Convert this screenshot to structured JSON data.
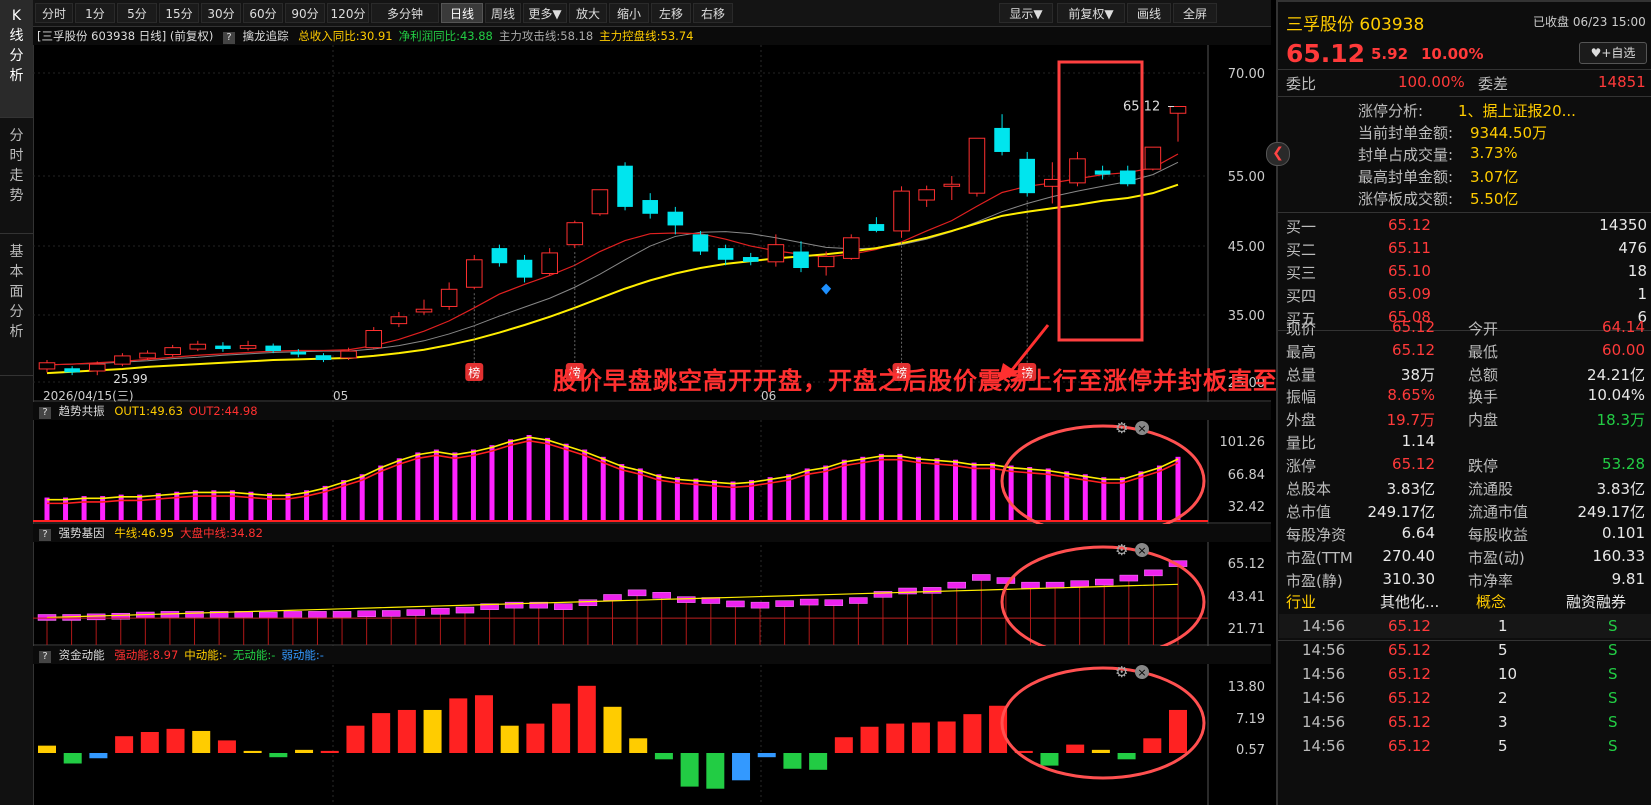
{
  "toolbar": {
    "buttons": [
      "分时",
      "1分",
      "5分",
      "15分",
      "30分",
      "60分",
      "90分",
      "120分",
      "多分钟",
      "日线",
      "周线",
      "更多▼",
      "放大",
      "缩小",
      "左移",
      "右移"
    ],
    "right_buttons": [
      "显示▼",
      "前复权▼",
      "画线",
      "全屏"
    ]
  },
  "left_tabs": [
    "K线分析",
    "分时走势",
    "基本面分析"
  ],
  "main_header": {
    "title": "[三孚股份 603938 日线] (前复权)",
    "indicator": "擒龙追踪",
    "items": [
      {
        "text": "总收入同比:30.91",
        "color": "#ffcc00"
      },
      {
        "text": "净利润同比:43.88",
        "color": "#22cc44"
      },
      {
        "text": "主力攻击线:58.18",
        "color": "#aaaaaa"
      },
      {
        "text": "主力控盘线:53.74",
        "color": "#ffcc00"
      }
    ]
  },
  "price_axis": [
    "70.00",
    "55.00",
    "45.00",
    "35.00",
    "25.00"
  ],
  "date_labels": {
    "left": "2026/04/15(三)",
    "m1": "05",
    "m2": "06"
  },
  "low_label": "25.99",
  "high_label": "65.12",
  "bang_label": "榜",
  "annotation": "股价早盘跳空高开开盘，开盘之后股价震荡上行至涨停并封板直至尾盘收盘",
  "pane2": {
    "title": "趋势共振",
    "items": [
      {
        "text": "OUT1:49.63",
        "color": "#ffcc00"
      },
      {
        "text": "OUT2:44.98",
        "color": "#ff3030"
      }
    ],
    "axis": [
      "101.26",
      "66.84",
      "32.42"
    ]
  },
  "pane3": {
    "title": "强势基因",
    "items": [
      {
        "text": "牛线:46.95",
        "color": "#ffcc00"
      },
      {
        "text": "大盘中线:34.82",
        "color": "#ff3030"
      }
    ],
    "axis": [
      "65.12",
      "43.41",
      "21.71"
    ]
  },
  "pane4": {
    "title": "资金动能",
    "items": [
      {
        "text": "强动能:8.97",
        "color": "#ff3030"
      },
      {
        "text": "中动能:-",
        "color": "#ffcc00"
      },
      {
        "text": "无动能:-",
        "color": "#22cc44"
      },
      {
        "text": "弱动能:-",
        "color": "#3399ff"
      }
    ],
    "axis": [
      "13.80",
      "7.19",
      "0.57"
    ]
  },
  "quote": {
    "name": "三孚股份 603938",
    "status": "已收盘 06/23 15:00",
    "price": "65.12",
    "change": "5.92",
    "pct": "10.00%",
    "fav": "+自选",
    "weibi_label": "委比",
    "weibi": "100.00%",
    "weicha_label": "委差",
    "weicha": "14851",
    "limit_info": [
      {
        "k": "涨停分析:",
        "v": "1、据上证报20..."
      },
      {
        "k": "当前封单金额:",
        "v": "9344.50万"
      },
      {
        "k": "封单占成交量:",
        "v": "3.73%"
      },
      {
        "k": "最高封单金额:",
        "v": "3.07亿"
      },
      {
        "k": "涨停板成交额:",
        "v": "5.50亿"
      }
    ],
    "bids": [
      {
        "k": "买一",
        "p": "65.12",
        "v": "14350"
      },
      {
        "k": "买二",
        "p": "65.11",
        "v": "476"
      },
      {
        "k": "买三",
        "p": "65.10",
        "v": "18"
      },
      {
        "k": "买四",
        "p": "65.09",
        "v": "1"
      },
      {
        "k": "买五",
        "p": "65.08",
        "v": "6"
      }
    ],
    "stats1": [
      {
        "k1": "现价",
        "v1": "65.12",
        "c1": "red",
        "k2": "今开",
        "v2": "64.14",
        "c2": "red"
      },
      {
        "k1": "最高",
        "v1": "65.12",
        "c1": "red",
        "k2": "最低",
        "v2": "60.00",
        "c2": "red"
      },
      {
        "k1": "总量",
        "v1": "38万",
        "c1": "white",
        "k2": "总额",
        "v2": "24.21亿",
        "c2": "white"
      }
    ],
    "stats2": [
      {
        "k1": "振幅",
        "v1": "8.65%",
        "c1": "red",
        "k2": "换手",
        "v2": "10.04%",
        "c2": "white"
      },
      {
        "k1": "外盘",
        "v1": "19.7万",
        "c1": "red",
        "k2": "内盘",
        "v2": "18.3万",
        "c2": "green"
      },
      {
        "k1": "量比",
        "v1": "1.14",
        "c1": "white",
        "k2": "",
        "v2": "",
        "c2": "white"
      }
    ],
    "stats3": [
      {
        "k1": "涨停",
        "v1": "65.12",
        "c1": "red",
        "k2": "跌停",
        "v2": "53.28",
        "c2": "green"
      },
      {
        "k1": "总股本",
        "v1": "3.83亿",
        "c1": "white",
        "k2": "流通股",
        "v2": "3.83亿",
        "c2": "white"
      },
      {
        "k1": "总市值",
        "v1": "249.17亿",
        "c1": "white",
        "k2": "流通市值",
        "v2": "249.17亿",
        "c2": "white"
      },
      {
        "k1": "每股净资",
        "v1": "6.64",
        "c1": "white",
        "k2": "每股收益",
        "v2": "0.101",
        "c2": "white"
      },
      {
        "k1": "市盈(TTM",
        "v1": "270.40",
        "c1": "white",
        "k2": "市盈(动)",
        "v2": "160.33",
        "c2": "white"
      },
      {
        "k1": "市盈(静)",
        "v1": "310.30",
        "c1": "white",
        "k2": "市净率",
        "v2": "9.81",
        "c2": "white"
      }
    ],
    "tags": [
      "行业",
      "其他化...",
      "概念",
      "融资融券"
    ],
    "ticks": [
      {
        "t": "14:56",
        "p": "65.12",
        "v": "1",
        "s": "S"
      },
      {
        "t": "14:56",
        "p": "65.12",
        "v": "5",
        "s": "S"
      },
      {
        "t": "14:56",
        "p": "65.12",
        "v": "10",
        "s": "S"
      },
      {
        "t": "14:56",
        "p": "65.12",
        "v": "2",
        "s": "S"
      },
      {
        "t": "14:56",
        "p": "65.12",
        "v": "3",
        "s": "S"
      },
      {
        "t": "14:56",
        "p": "65.12",
        "v": "5",
        "s": "S"
      }
    ]
  },
  "chart_data": {
    "type": "candlestick",
    "ylim": [
      25,
      72
    ],
    "candles": [
      {
        "o": 26.9,
        "c": 27.8,
        "h": 28.2,
        "l": 26.4
      },
      {
        "o": 27.0,
        "c": 26.4,
        "h": 27.3,
        "l": 26.0
      },
      {
        "o": 26.6,
        "c": 27.6,
        "h": 28.0,
        "l": 25.99
      },
      {
        "o": 27.6,
        "c": 28.8,
        "h": 29.2,
        "l": 27.3
      },
      {
        "o": 28.5,
        "c": 29.2,
        "h": 29.6,
        "l": 28.2
      },
      {
        "o": 29.0,
        "c": 30.0,
        "h": 30.4,
        "l": 28.7
      },
      {
        "o": 29.8,
        "c": 30.5,
        "h": 31.0,
        "l": 29.5
      },
      {
        "o": 30.3,
        "c": 29.8,
        "h": 30.8,
        "l": 29.4
      },
      {
        "o": 29.9,
        "c": 30.3,
        "h": 31.0,
        "l": 29.6
      },
      {
        "o": 30.3,
        "c": 29.5,
        "h": 30.6,
        "l": 29.2
      },
      {
        "o": 29.4,
        "c": 29.0,
        "h": 29.8,
        "l": 28.6
      },
      {
        "o": 28.9,
        "c": 28.2,
        "h": 29.2,
        "l": 27.9
      },
      {
        "o": 28.5,
        "c": 29.5,
        "h": 30.0,
        "l": 28.2
      },
      {
        "o": 30.0,
        "c": 32.5,
        "h": 33.0,
        "l": 29.8
      },
      {
        "o": 33.5,
        "c": 34.5,
        "h": 35.2,
        "l": 33.0
      },
      {
        "o": 35.2,
        "c": 35.6,
        "h": 37.0,
        "l": 34.8
      },
      {
        "o": 36.0,
        "c": 38.5,
        "h": 39.5,
        "l": 35.5
      },
      {
        "o": 38.8,
        "c": 42.8,
        "h": 43.5,
        "l": 38.5
      },
      {
        "o": 44.5,
        "c": 42.3,
        "h": 45.0,
        "l": 41.8
      },
      {
        "o": 42.8,
        "c": 40.2,
        "h": 43.5,
        "l": 39.5
      },
      {
        "o": 40.8,
        "c": 43.8,
        "h": 44.5,
        "l": 40.5
      },
      {
        "o": 45.0,
        "c": 48.2,
        "h": 48.5,
        "l": 44.5
      },
      {
        "o": 49.5,
        "c": 53.0,
        "h": 53.0,
        "l": 49.2
      },
      {
        "o": 56.5,
        "c": 50.5,
        "h": 57.0,
        "l": 50.0
      },
      {
        "o": 51.5,
        "c": 49.5,
        "h": 52.5,
        "l": 48.8
      },
      {
        "o": 49.8,
        "c": 47.8,
        "h": 50.5,
        "l": 46.5
      },
      {
        "o": 46.5,
        "c": 44.0,
        "h": 47.0,
        "l": 43.5
      },
      {
        "o": 44.5,
        "c": 42.8,
        "h": 45.0,
        "l": 42.0
      },
      {
        "o": 43.2,
        "c": 42.5,
        "h": 43.8,
        "l": 42.0
      },
      {
        "o": 42.5,
        "c": 45.0,
        "h": 46.5,
        "l": 41.8
      },
      {
        "o": 44.0,
        "c": 41.6,
        "h": 45.5,
        "l": 41.0
      },
      {
        "o": 41.8,
        "c": 43.3,
        "h": 44.0,
        "l": 40.5
      },
      {
        "o": 43.0,
        "c": 46.0,
        "h": 46.5,
        "l": 42.8
      },
      {
        "o": 48.0,
        "c": 47.0,
        "h": 49.0,
        "l": 46.8
      },
      {
        "o": 47.0,
        "c": 52.8,
        "h": 53.5,
        "l": 46.0
      },
      {
        "o": 51.5,
        "c": 53.0,
        "h": 53.6,
        "l": 50.5
      },
      {
        "o": 53.5,
        "c": 53.8,
        "h": 55.0,
        "l": 51.5
      },
      {
        "o": 52.5,
        "c": 60.5,
        "h": 60.5,
        "l": 52.0
      },
      {
        "o": 62.0,
        "c": 58.5,
        "h": 64.0,
        "l": 58.0
      },
      {
        "o": 57.5,
        "c": 52.5,
        "h": 58.5,
        "l": 52.0
      },
      {
        "o": 53.5,
        "c": 54.5,
        "h": 57.0,
        "l": 51.0
      },
      {
        "o": 54.0,
        "c": 57.5,
        "h": 58.5,
        "l": 53.5
      },
      {
        "o": 55.8,
        "c": 55.2,
        "h": 56.5,
        "l": 54.5
      },
      {
        "o": 55.8,
        "c": 53.8,
        "h": 56.5,
        "l": 53.5
      },
      {
        "o": 56.0,
        "c": 59.2,
        "h": 59.2,
        "l": 55.8
      },
      {
        "o": 64.14,
        "c": 65.12,
        "h": 65.12,
        "l": 60.0
      }
    ],
    "ma_red": [
      27.5,
      27.6,
      27.8,
      28.0,
      28.3,
      28.6,
      28.9,
      29.1,
      29.3,
      29.5,
      29.6,
      29.6,
      29.7,
      30.3,
      31.2,
      32.4,
      33.9,
      35.8,
      37.8,
      39.2,
      40.5,
      42.0,
      44.0,
      45.6,
      46.6,
      46.7,
      46.6,
      45.8,
      44.8,
      44.1,
      43.6,
      43.2,
      43.6,
      44.3,
      45.4,
      47.0,
      48.5,
      50.6,
      52.6,
      53.5,
      54.0,
      54.6,
      55.2,
      55.5,
      56.2,
      58.2
    ],
    "ma_gray": [
      27.5,
      27.6,
      27.7,
      27.9,
      28.1,
      28.4,
      28.6,
      28.9,
      29.1,
      29.3,
      29.4,
      29.5,
      29.5,
      29.8,
      30.3,
      31.0,
      32.0,
      33.2,
      34.6,
      35.9,
      37.2,
      38.8,
      40.7,
      42.8,
      44.8,
      46.2,
      46.8,
      46.9,
      46.6,
      46.0,
      45.3,
      44.6,
      44.4,
      44.5,
      45.0,
      45.8,
      46.9,
      48.3,
      49.8,
      51.0,
      52.0,
      52.8,
      53.5,
      54.2,
      55.2,
      57.0
    ],
    "ma_yellow": [
      26.3,
      26.5,
      26.7,
      26.9,
      27.2,
      27.4,
      27.6,
      27.8,
      28.0,
      28.2,
      28.3,
      28.4,
      28.5,
      28.8,
      29.2,
      29.7,
      30.4,
      31.2,
      32.2,
      33.3,
      34.5,
      35.8,
      37.2,
      38.6,
      39.8,
      40.8,
      41.6,
      42.2,
      42.6,
      43.0,
      43.3,
      43.6,
      44.0,
      44.5,
      45.2,
      46.0,
      47.0,
      48.1,
      49.2,
      49.8,
      50.3,
      50.8,
      51.4,
      51.8,
      52.5,
      53.74
    ],
    "bang_idx": [
      17,
      21,
      34,
      39
    ],
    "trend_bars": [
      12,
      12,
      13,
      13,
      14,
      14,
      15,
      16,
      17,
      17,
      17,
      16,
      15,
      15,
      17,
      20,
      24,
      28,
      34,
      39,
      43,
      45,
      43,
      45,
      48,
      52,
      55,
      53,
      49,
      45,
      40,
      35,
      32,
      28,
      26,
      25,
      24,
      23,
      24,
      26,
      28,
      32,
      34,
      38,
      40,
      42,
      42,
      40,
      39,
      38,
      36,
      36,
      34,
      33,
      32,
      30,
      28,
      26,
      26,
      30,
      34,
      40
    ],
    "gene_bars": [
      7.0,
      7.0,
      7.2,
      7.4,
      7.8,
      8.0,
      8.0,
      8.0,
      8.0,
      7.8,
      8.0,
      8.0,
      8.0,
      8.2,
      8.3,
      8.6,
      9.0,
      9.4,
      10.5,
      11.0,
      11.0,
      10.5,
      11.8,
      13.5,
      15.0,
      14.2,
      12.8,
      12.5,
      11.4,
      11.0,
      11.5,
      12.0,
      11.8,
      12.5,
      14.5,
      15.6,
      15.8,
      17.5,
      20.0,
      19.0,
      17.5,
      17.5,
      18.0,
      18.5,
      19.8,
      21.5,
      24.5
    ],
    "money_bars": [
      {
        "v": 0.7,
        "c": "#ffcc00"
      },
      {
        "v": -1.0,
        "c": "#22cc44"
      },
      {
        "v": -0.5,
        "c": "#3399ff"
      },
      {
        "v": 1.6,
        "c": "#ff2222"
      },
      {
        "v": 2.0,
        "c": "#ff2222"
      },
      {
        "v": 2.3,
        "c": "#ff2222"
      },
      {
        "v": 2.1,
        "c": "#ffcc00"
      },
      {
        "v": 1.2,
        "c": "#ff2222"
      },
      {
        "v": 0.2,
        "c": "#ffcc00"
      },
      {
        "v": -0.4,
        "c": "#22cc44"
      },
      {
        "v": 0.3,
        "c": "#ffcc00"
      },
      {
        "v": 0.2,
        "c": "#ff2222"
      },
      {
        "v": 2.6,
        "c": "#ff2222"
      },
      {
        "v": 3.8,
        "c": "#ff2222"
      },
      {
        "v": 4.1,
        "c": "#ff2222"
      },
      {
        "v": 4.1,
        "c": "#ffcc00"
      },
      {
        "v": 5.2,
        "c": "#ff2222"
      },
      {
        "v": 5.5,
        "c": "#ff2222"
      },
      {
        "v": 2.6,
        "c": "#ffcc00"
      },
      {
        "v": 2.8,
        "c": "#ff2222"
      },
      {
        "v": 4.7,
        "c": "#ff2222"
      },
      {
        "v": 6.4,
        "c": "#ff2222"
      },
      {
        "v": 4.4,
        "c": "#ffcc00"
      },
      {
        "v": 1.4,
        "c": "#ffcc00"
      },
      {
        "v": -0.6,
        "c": "#22cc44"
      },
      {
        "v": -3.2,
        "c": "#22cc44"
      },
      {
        "v": -3.4,
        "c": "#22cc44"
      },
      {
        "v": -2.6,
        "c": "#3399ff"
      },
      {
        "v": -0.4,
        "c": "#3399ff"
      },
      {
        "v": -1.5,
        "c": "#22cc44"
      },
      {
        "v": -1.6,
        "c": "#22cc44"
      },
      {
        "v": 1.5,
        "c": "#ff2222"
      },
      {
        "v": 2.5,
        "c": "#ff2222"
      },
      {
        "v": 2.8,
        "c": "#ff2222"
      },
      {
        "v": 2.9,
        "c": "#ff2222"
      },
      {
        "v": 3.0,
        "c": "#ff2222"
      },
      {
        "v": 3.7,
        "c": "#ff2222"
      },
      {
        "v": 4.5,
        "c": "#ff2222"
      },
      {
        "v": 0.2,
        "c": "#ff2222"
      },
      {
        "v": -1.2,
        "c": "#22cc44"
      },
      {
        "v": 0.8,
        "c": "#ff2222"
      },
      {
        "v": 0.3,
        "c": "#ffcc00"
      },
      {
        "v": -0.6,
        "c": "#22cc44"
      },
      {
        "v": 1.4,
        "c": "#ff2222"
      },
      {
        "v": 4.1,
        "c": "#ff2222"
      }
    ]
  }
}
